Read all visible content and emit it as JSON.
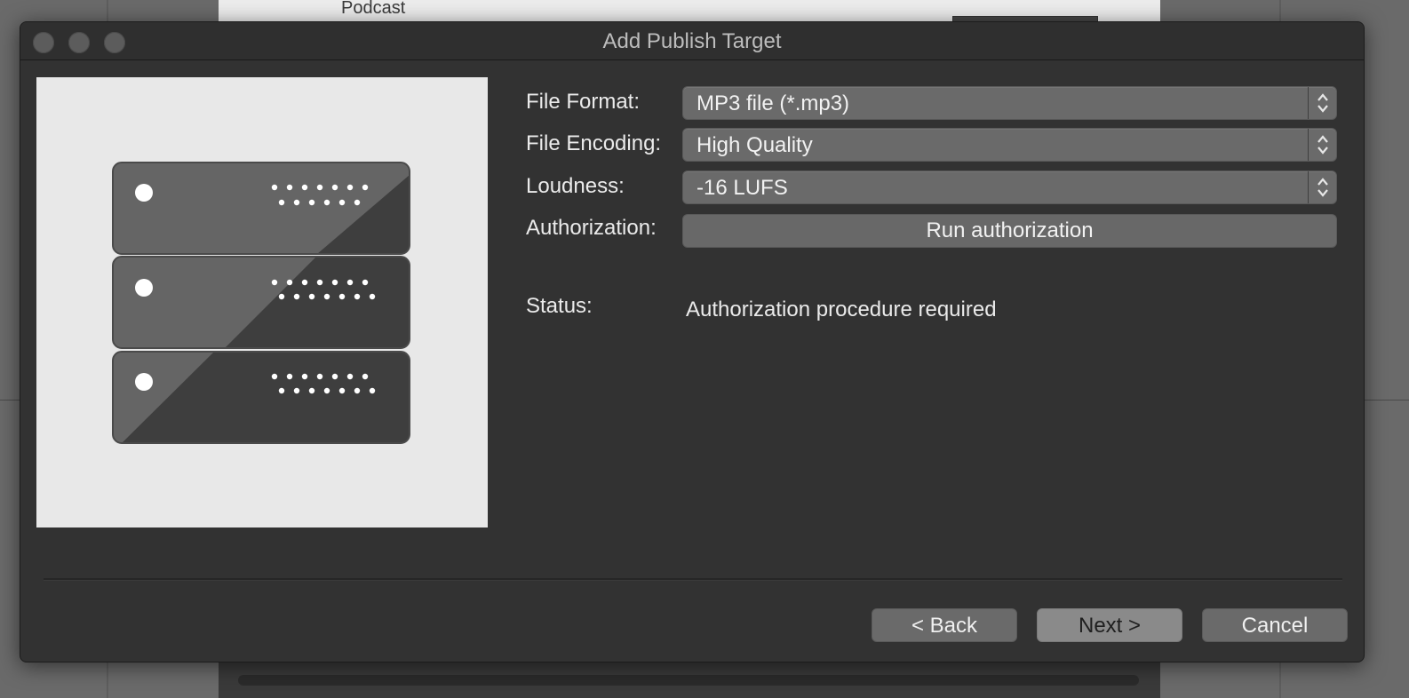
{
  "background": {
    "panel_label": "Podcast"
  },
  "dialog": {
    "title": "Add Publish Target",
    "window_controls": [
      "close",
      "minimize",
      "zoom"
    ],
    "preview_icon": "server-rack-icon",
    "fields": {
      "file_format": {
        "label": "File Format:",
        "value": "MP3 file (*.mp3)"
      },
      "file_encoding": {
        "label": "File Encoding:",
        "value": "High Quality"
      },
      "loudness": {
        "label": "Loudness:",
        "value": "-16 LUFS"
      },
      "authorization": {
        "label": "Authorization:",
        "button_label": "Run authorization"
      },
      "status": {
        "label": "Status:",
        "value": "Authorization procedure required"
      }
    },
    "buttons": {
      "back": "< Back",
      "next": "Next >",
      "cancel": "Cancel"
    }
  },
  "colors": {
    "dialog_bg": "#323232",
    "control_bg": "#6a6a6a",
    "primary_button_bg": "#8a8a8a",
    "preview_bg": "#e8e8e8"
  }
}
